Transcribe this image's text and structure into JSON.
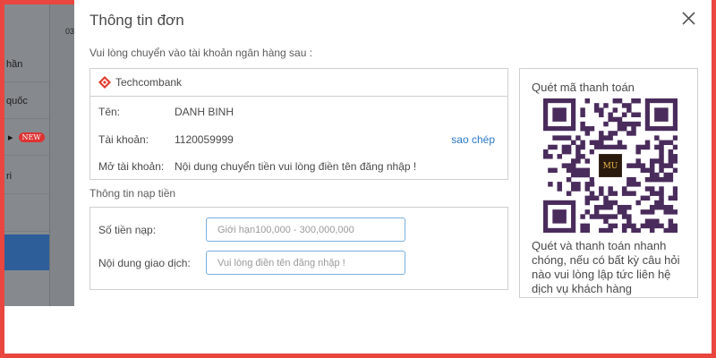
{
  "background": {
    "partial_number": "03",
    "sidebar_items": [
      {
        "label": "hần",
        "badge": ""
      },
      {
        "label": "quốc",
        "badge": ""
      },
      {
        "label": "",
        "badge": "NEW"
      },
      {
        "label": "ri",
        "badge": ""
      },
      {
        "label": "",
        "badge": ""
      },
      {
        "label": "",
        "badge": "",
        "active": true
      }
    ]
  },
  "modal": {
    "title": "Thông tin đơn",
    "intro": "Vui lòng chuyển vào tài khoản ngân hàng sau :",
    "bank": {
      "name": "Techcombank",
      "name_label": "Tên:",
      "name_value": "DANH BINH",
      "account_label": "Tài khoản:",
      "account_value": "1120059999",
      "copy_label": "sao chép",
      "open_label": "Mở tài khoản:",
      "open_value": "Nội dung chuyển tiền vui lòng điền tên đăng nhập !"
    },
    "deposit": {
      "section_label": "Thông tin nạp tiền",
      "amount_label": "Số tiền nạp:",
      "amount_placeholder": "Giới hạn100,000 - 300,000,000",
      "amount_value": "",
      "content_label": "Nội dung giao dịch:",
      "content_placeholder": "Vui lòng điền tên đăng nhập !",
      "content_value": ""
    },
    "qr": {
      "title": "Quét mã thanh toán",
      "center_label": "MU",
      "description": "Quét và thanh toán nhanh chóng, nếu có bất kỳ câu hỏi nào vui lòng lập tức liên hệ dịch vụ khách hàng"
    }
  },
  "colors": {
    "accent_link": "#2a78c8",
    "qr_color": "#4a2c5c",
    "frame_border": "#e8463f",
    "brand_red": "#e8463f"
  }
}
